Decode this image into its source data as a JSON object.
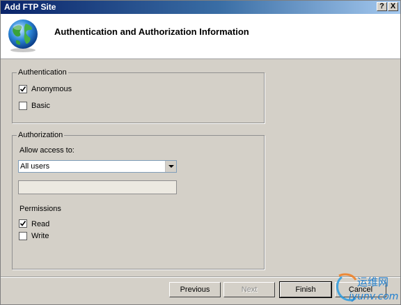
{
  "window": {
    "title": "Add FTP Site",
    "help_glyph": "?",
    "close_glyph": "X"
  },
  "header": {
    "title": "Authentication and Authorization Information"
  },
  "authentication": {
    "legend": "Authentication",
    "anonymous": {
      "label": "Anonymous",
      "checked": true
    },
    "basic": {
      "label": "Basic",
      "checked": false
    }
  },
  "authorization": {
    "legend": "Authorization",
    "allow_label": "Allow access to:",
    "allow_selected": "All users",
    "users_field_value": "",
    "permissions_label": "Permissions",
    "read": {
      "label": "Read",
      "checked": true
    },
    "write": {
      "label": "Write",
      "checked": false
    }
  },
  "buttons": {
    "previous": "Previous",
    "next": "Next",
    "finish": "Finish",
    "cancel": "Cancel"
  },
  "watermark": {
    "text": "运维网",
    "url": "iyunv.com"
  }
}
